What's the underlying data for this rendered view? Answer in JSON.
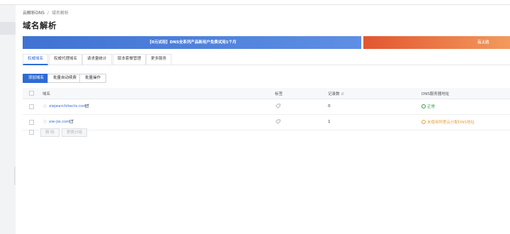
{
  "breadcrumb": {
    "root": "云解析DNS",
    "separator": "/",
    "current": "域名解析"
  },
  "page": {
    "title": "域名解析"
  },
  "banners": [
    {
      "text": "【0元试用】DNS全系列产品新用户免费试用1个月",
      "color": "#3f72d3"
    },
    {
      "text": "云上达",
      "color": "#e2562f"
    }
  ],
  "tabs": [
    {
      "label": "权威域名",
      "active": true
    },
    {
      "label": "权威代理域名",
      "active": false
    },
    {
      "label": "请求量统计",
      "active": false
    },
    {
      "label": "版本套餐管理",
      "active": false
    },
    {
      "label": "更多服务",
      "active": false
    }
  ],
  "toolbar": {
    "add_domain": "添加域名",
    "batch_renew": "批量自动续费",
    "batch_ops": "批量操作"
  },
  "table": {
    "columns": {
      "domain": "域名",
      "tag": "标签",
      "records": "记录数",
      "dns_server": "DNS服务器地址"
    },
    "rows": [
      {
        "domain": "xiejearchitects.com",
        "records": "0",
        "status": "正常",
        "status_type": "ok"
      },
      {
        "domain": "xie-jie.com",
        "records": "1",
        "status": "未使用阿里云分配DNS地址",
        "status_type": "warn"
      }
    ]
  },
  "footer": {
    "delete": "删 除",
    "change_group": "更换分组"
  },
  "colors": {
    "accent": "#2f6bd4",
    "ok": "#2f9e44",
    "warn": "#e6a23c"
  }
}
